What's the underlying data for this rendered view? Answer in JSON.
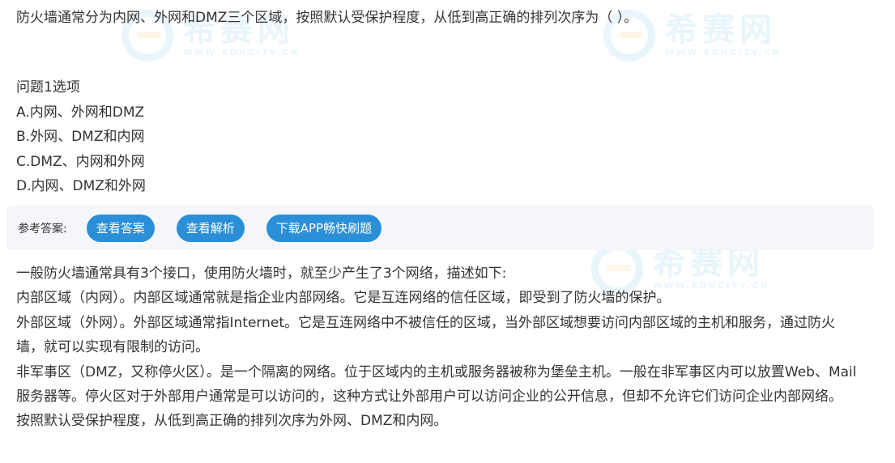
{
  "watermark": {
    "main": "希赛网",
    "sub": "WWW.EDUCITY.CN"
  },
  "question": {
    "text": "防火墙通常分为内网、外网和DMZ三个区域，按照默认受保护程度，从低到高正确的排列次序为（  ）。",
    "options_title": "问题1选项",
    "options": [
      "A.内网、外网和DMZ",
      "B.外网、DMZ和内网",
      "C.DMZ、内网和外网",
      "D.内网、DMZ和外网"
    ]
  },
  "answer_bar": {
    "label": "参考答案:",
    "buttons": {
      "view_answer": "查看答案",
      "view_analysis": "查看解析",
      "download_app": "下载APP畅快刷题"
    }
  },
  "explanation": {
    "paragraphs": [
      "一般防火墙通常具有3个接口，使用防火墙时，就至少产生了3个网络，描述如下:",
      "内部区域（内网）。内部区域通常就是指企业内部网络。它是互连网络的信任区域，即受到了防火墙的保护。",
      "外部区域（外网）。外部区域通常指Internet。它是互连网络中不被信任的区域，当外部区域想要访问内部区域的主机和服务，通过防火墙，就可以实现有限制的访问。",
      "非军事区（DMZ，又称停火区）。是一个隔离的网络。位于区域内的主机或服务器被称为堡垒主机。一般在非军事区内可以放置Web、Mail服务器等。停火区对于外部用户通常是可以访问的，这种方式让外部用户可以访问企业的公开信息，但却不允许它们访问企业内部网络。",
      "按照默认受保护程度，从低到高正确的排列次序为外网、DMZ和内网。"
    ]
  },
  "colors": {
    "accent": "#2b8fd8",
    "bar_bg": "#f4f6f9",
    "text": "#333333"
  }
}
